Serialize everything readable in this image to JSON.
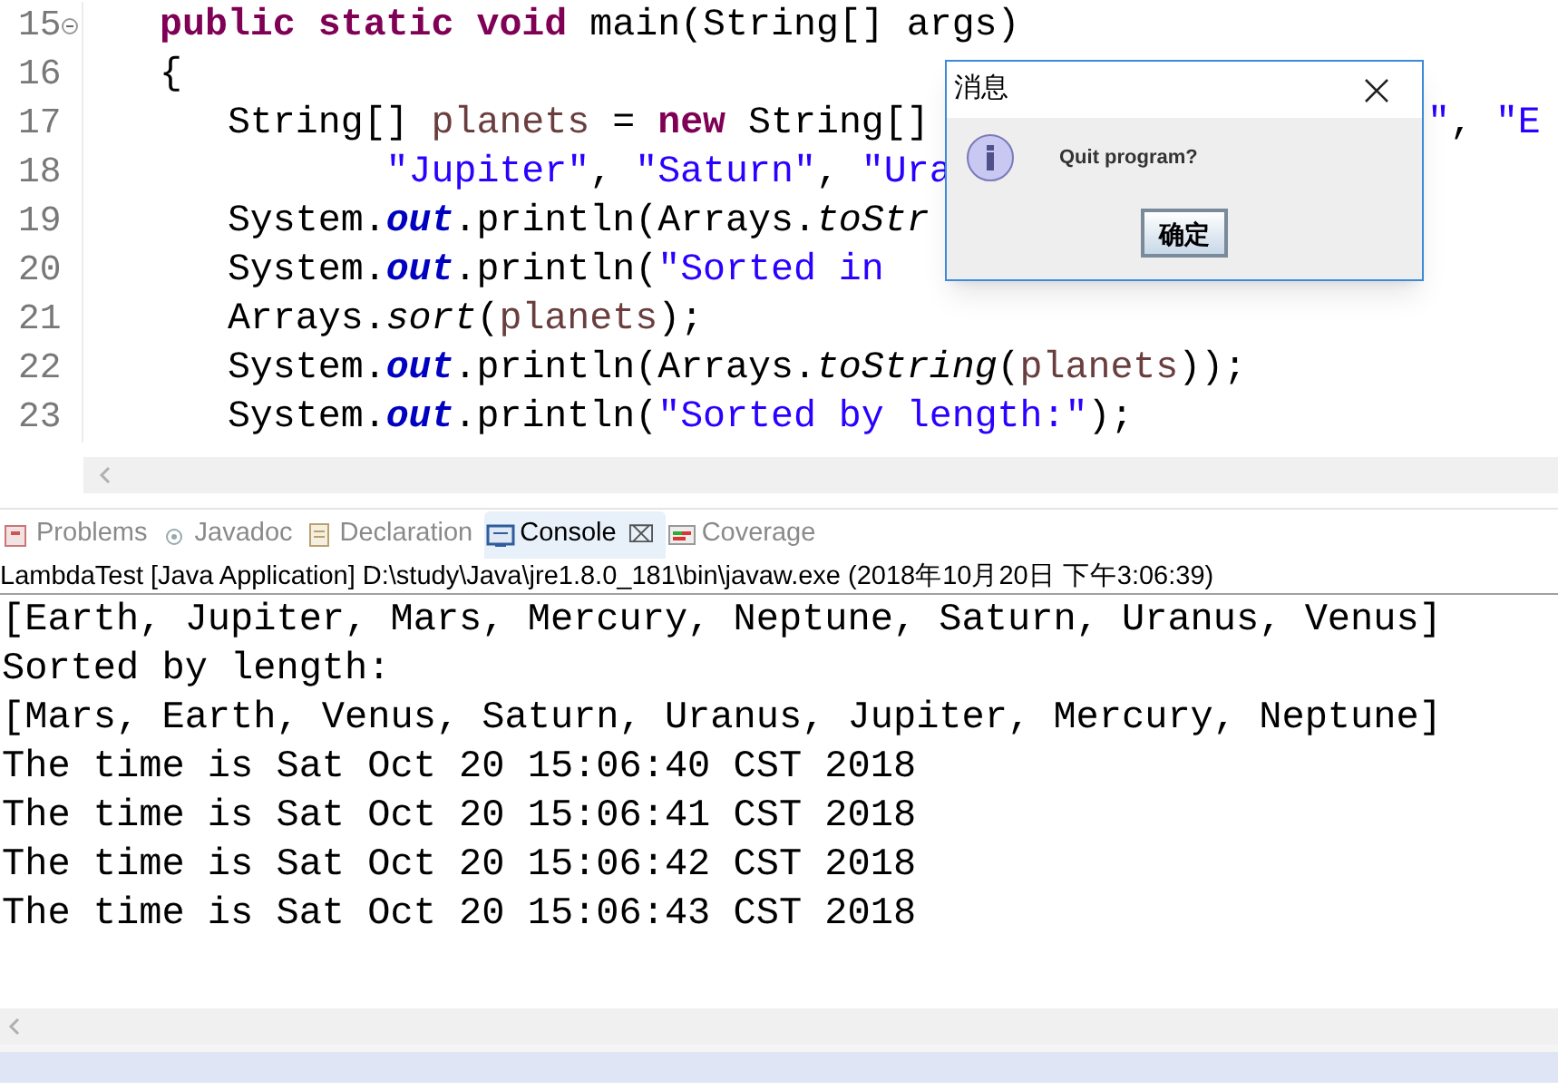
{
  "editor": {
    "lines": [
      {
        "number": "15",
        "folding": true,
        "tokens": [
          {
            "kind": "keyword",
            "text": "public static void"
          },
          {
            "kind": "plain",
            "text": " main(String[] args)"
          }
        ]
      },
      {
        "number": "16",
        "folding": false,
        "tokens": [
          {
            "kind": "plain",
            "text": "{"
          }
        ]
      },
      {
        "number": "17",
        "folding": false,
        "tokens": [
          {
            "kind": "plain",
            "text": "   String[] "
          },
          {
            "kind": "variable",
            "text": "planets"
          },
          {
            "kind": "plain",
            "text": " = "
          },
          {
            "kind": "keyword",
            "text": "new"
          },
          {
            "kind": "plain",
            "text": " String[]"
          }
        ],
        "tail": [
          {
            "kind": "string",
            "text": "\""
          },
          {
            "kind": "plain",
            "text": ", "
          },
          {
            "kind": "string",
            "text": "\"E"
          }
        ]
      },
      {
        "number": "18",
        "folding": false,
        "tokens": [
          {
            "kind": "string",
            "text": "          \"Jupiter\""
          },
          {
            "kind": "plain",
            "text": ", "
          },
          {
            "kind": "string",
            "text": "\"Saturn\""
          },
          {
            "kind": "plain",
            "text": ", "
          },
          {
            "kind": "string",
            "text": "\"Ura"
          }
        ]
      },
      {
        "number": "19",
        "folding": false,
        "tokens": [
          {
            "kind": "plain",
            "text": "   System."
          },
          {
            "kind": "field",
            "text": "out"
          },
          {
            "kind": "plain",
            "text": ".println(Arrays."
          },
          {
            "kind": "method",
            "text": "toStr"
          }
        ]
      },
      {
        "number": "20",
        "folding": false,
        "tokens": [
          {
            "kind": "plain",
            "text": "   System."
          },
          {
            "kind": "field",
            "text": "out"
          },
          {
            "kind": "plain",
            "text": ".println("
          },
          {
            "kind": "string",
            "text": "\"Sorted in"
          }
        ]
      },
      {
        "number": "21",
        "folding": false,
        "tokens": [
          {
            "kind": "plain",
            "text": "   Arrays."
          },
          {
            "kind": "method",
            "text": "sort"
          },
          {
            "kind": "plain",
            "text": "("
          },
          {
            "kind": "variable",
            "text": "planets"
          },
          {
            "kind": "plain",
            "text": ");"
          }
        ]
      },
      {
        "number": "22",
        "folding": false,
        "tokens": [
          {
            "kind": "plain",
            "text": "   System."
          },
          {
            "kind": "field",
            "text": "out"
          },
          {
            "kind": "plain",
            "text": ".println(Arrays."
          },
          {
            "kind": "method",
            "text": "toString"
          },
          {
            "kind": "plain",
            "text": "("
          },
          {
            "kind": "variable",
            "text": "planets"
          },
          {
            "kind": "plain",
            "text": "));"
          }
        ]
      },
      {
        "number": "23",
        "folding": false,
        "tokens": [
          {
            "kind": "plain",
            "text": "   System."
          },
          {
            "kind": "field",
            "text": "out"
          },
          {
            "kind": "plain",
            "text": ".println("
          },
          {
            "kind": "string",
            "text": "\"Sorted by length:\""
          },
          {
            "kind": "plain",
            "text": ");"
          }
        ]
      }
    ]
  },
  "dialog": {
    "title": "消息",
    "message": "Quit program?",
    "button": "确定"
  },
  "tabs": [
    {
      "label": "Problems",
      "selected": false
    },
    {
      "label": "Javadoc",
      "selected": false
    },
    {
      "label": "Declaration",
      "selected": false
    },
    {
      "label": "Console",
      "selected": true,
      "close": "⌧"
    },
    {
      "label": "Coverage",
      "selected": false
    }
  ],
  "console": {
    "header": "LambdaTest [Java Application] D:\\study\\Java\\jre1.8.0_181\\bin\\javaw.exe (2018年10月20日 下午3:06:39)",
    "lines": [
      "[Earth, Jupiter, Mars, Mercury, Neptune, Saturn, Uranus, Venus]",
      "Sorted by length:",
      "[Mars, Earth, Venus, Saturn, Uranus, Jupiter, Mercury, Neptune]",
      "The time is Sat Oct 20 15:06:40 CST 2018",
      "The time is Sat Oct 20 15:06:41 CST 2018",
      "The time is Sat Oct 20 15:06:42 CST 2018",
      "The time is Sat Oct 20 15:06:43 CST 2018"
    ]
  }
}
